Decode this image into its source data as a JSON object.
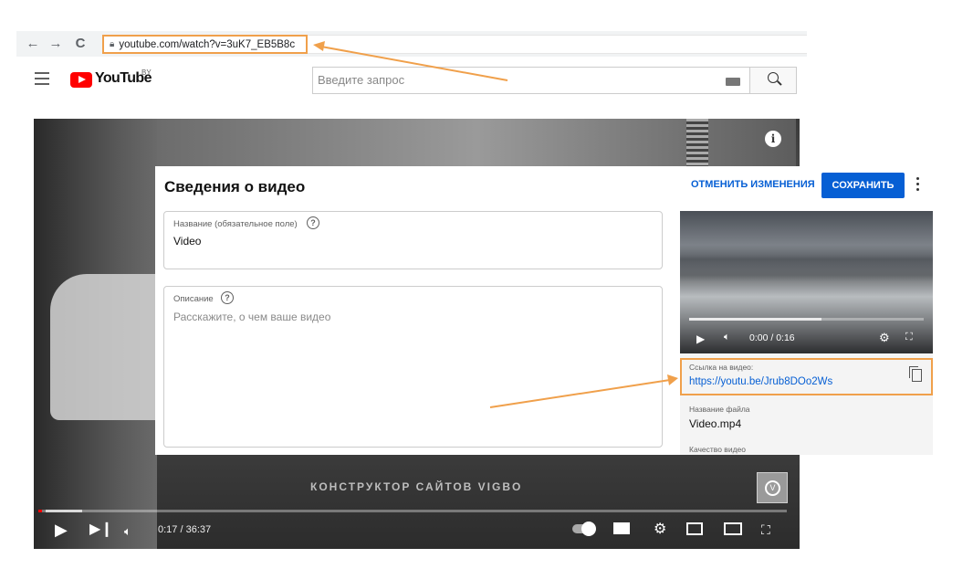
{
  "browser": {
    "back_icon": "←",
    "forward_icon": "→",
    "reload_icon": "C",
    "url": "youtube.com/watch?v=3uK7_EB5B8c"
  },
  "youtube": {
    "logo_text": "YouTube",
    "region": "BY",
    "search_placeholder": "Введите запрос"
  },
  "player": {
    "watermark": "КОНСТРУКТОР САЙТОВ VIGBO",
    "time": "0:17 / 36:37",
    "progress_fraction": 0.005,
    "info_icon": "i"
  },
  "edit": {
    "title": "Сведения о видео",
    "cancel_label": "ОТМЕНИТЬ ИЗМЕНЕНИЯ",
    "save_label": "СОХРАНИТЬ",
    "title_field_label": "Название (обязательное поле)",
    "title_field_value": "Video",
    "desc_field_label": "Описание",
    "desc_field_placeholder": "Расскажите, о чем ваше видео",
    "help_icon": "?"
  },
  "preview": {
    "time": "0:00 / 0:16",
    "link_label": "Ссылка на видео:",
    "link_value": "https://youtu.be/Jrub8DOo2Ws",
    "file_label": "Название файла",
    "file_value": "Video.mp4",
    "quality_label": "Качество видео"
  },
  "colors": {
    "accent": "#065fd4",
    "highlight": "#f0a04b",
    "youtube_red": "#ff0000"
  }
}
